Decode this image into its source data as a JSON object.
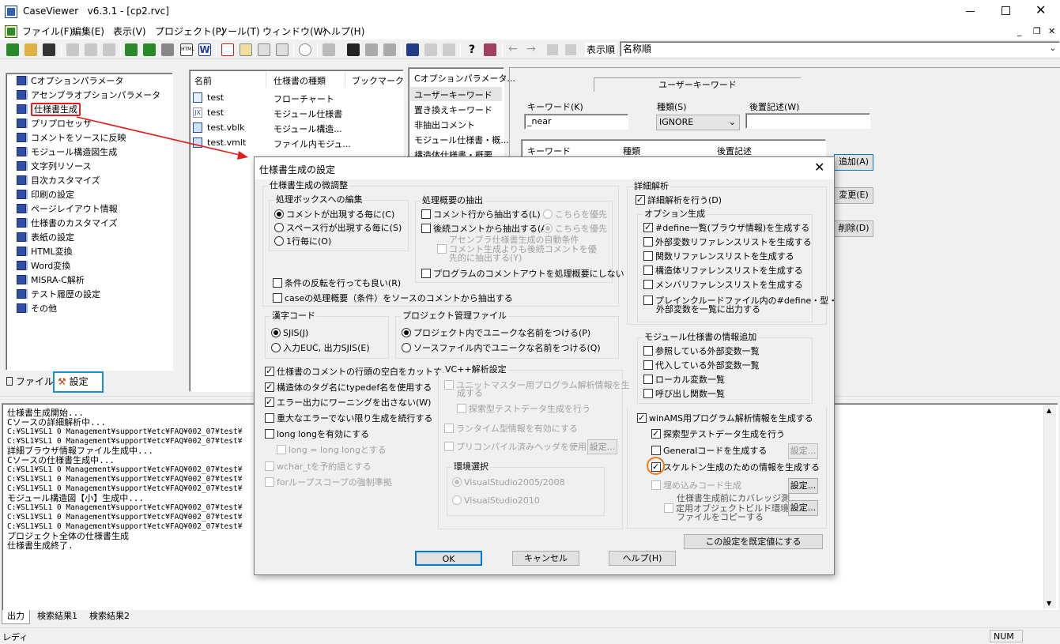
{
  "window": {
    "app": "CaseViewer",
    "version": "v6.3.1",
    "document": "[cp2.rvc]"
  },
  "menu": [
    "ファイル(F)",
    "編集(E)",
    "表示(V)",
    "プロジェクト(P)",
    "ツール(T)",
    "ウィンドウ(W)",
    "ヘルプ(H)"
  ],
  "toolbar": {
    "order_label": "表示順",
    "order_value": "名称順"
  },
  "tree": {
    "items": [
      "Cオプションパラメータ",
      "アセンブラオプションパラメータ",
      "仕様書生成",
      "プリプロセッサ",
      "コメントをソースに反映",
      "モジュール構造図生成",
      "文字列リソース",
      "目次カスタマイズ",
      "印刷の設定",
      "ページレイアウト情報",
      "仕様書のカスタマイズ",
      "表紙の設定",
      "HTML変換",
      "Word変換",
      "MISRA-C解析",
      "テスト履歴の設定",
      "その他"
    ],
    "tab_file": "ファイル",
    "tab_settings": "設定"
  },
  "file_list": {
    "headers": [
      "名前",
      "仕様書の種類",
      "ブックマーク"
    ],
    "rows": [
      {
        "name": "test",
        "type": "フローチャート"
      },
      {
        "name": "test",
        "type": "モジュール仕様書"
      },
      {
        "name": "test.vblk",
        "type": "モジュール構造..."
      },
      {
        "name": "test.vmlt",
        "type": "ファイル内モジュ..."
      }
    ]
  },
  "param_list": [
    "Cオプションパラメータ...",
    "ユーザーキーワード",
    "置き換えキーワード",
    "非抽出コメント",
    "モジュール仕様書・概...",
    "構造体仕様書・概要..."
  ],
  "user_keyword": {
    "title": "ユーザーキーワード",
    "keyword_label": "キーワード(K)",
    "keyword_value": "_near",
    "type_label": "種類(S)",
    "type_value": "IGNORE",
    "postfix_label": "後置記述(W)",
    "postfix_value": "",
    "table_headers": [
      "キーワード",
      "種類",
      "後置記述"
    ],
    "add_button": "追加(A)",
    "change_button": "変更(E)",
    "delete_button": "削除(D)"
  },
  "output": {
    "lines": [
      "仕様書生成開始...",
      "Cソースの詳細解析中...",
      "C:¥SL1¥SL1 0 Management¥support¥etc¥FAQ¥002_07¥test¥",
      "C:¥SL1¥SL1 0 Management¥support¥etc¥FAQ¥002_07¥test¥",
      "詳細ブラウザ情報ファイル生成中...",
      "Cソースの仕様書生成中...",
      "C:¥SL1¥SL1 0 Management¥support¥etc¥FAQ¥002_07¥test¥",
      "C:¥SL1¥SL1 0 Management¥support¥etc¥FAQ¥002_07¥test¥",
      "C:¥SL1¥SL1 0 Management¥support¥etc¥FAQ¥002_07¥test¥",
      "モジュール構造図【小】生成中...",
      "C:¥SL1¥SL1 0 Management¥support¥etc¥FAQ¥002_07¥test¥",
      "C:¥SL1¥SL1 0 Management¥support¥etc¥FAQ¥002_07¥test¥",
      "C:¥SL1¥SL1 0 Management¥support¥etc¥FAQ¥002_07¥test¥",
      "プロジェクト全体の仕様書生成",
      "仕様書生成終了."
    ],
    "tabs": [
      "出力",
      "検索結果1",
      "検索結果2"
    ]
  },
  "status": {
    "text": "レディ",
    "num": "NUM"
  },
  "dialog": {
    "title": "仕様書生成の設定",
    "fine_group": "仕様書生成の微調整",
    "processbox_group": "処理ボックスへの編集",
    "processbox_opts": [
      "コメントが出現する毎に(C)",
      "スペース行が出現する毎に(S)",
      "1行毎に(O)"
    ],
    "summary_group": "処理概要の抽出",
    "summary_opt1": "コメント行から抽出する(L)",
    "summary_opt1_pri": "こちらを優先",
    "summary_opt2": "後続コメントから抽出する(A)",
    "summary_opt2_pri": "こちらを優先",
    "asm_line1": "アセンブラ仕様書生成の自動条件",
    "asm_line2": "コメント生成よりも後続コメントを優",
    "asm_line3": "先的に抽出する(Y)",
    "no_commentout": "プログラムのコメントアウトを処理概要にしない",
    "cond_reverse": "条件の反転を行っても良い(R)",
    "case_summary": "caseの処理概要（条件）をソースのコメントから抽出する",
    "kanji_group": "漢字コード",
    "kanji_opts": [
      "SJIS(J)",
      "入力EUC, 出力SJIS(E)"
    ],
    "projfile_group": "プロジェクト管理ファイル",
    "projfile_opts": [
      "プロジェクト内でユニークな名前をつける(P)",
      "ソースファイル内でユニークな名前をつける(Q)"
    ],
    "left_checks": [
      "仕様書のコメントの行頭の空白をカットする",
      "構造体のタグ名にtypedef名を使用する",
      "エラー出力にワーニングを出さない(W)",
      "重大なエラーでない限り生成を続行する",
      "long longを有効にする",
      "long = long longとする",
      "wchar_tを予約語とする",
      "forループスコープの強制準拠"
    ],
    "vc_group": "VC++解析設定",
    "vc_opt1a": "ユニットマスター用プログラム解析情報を生",
    "vc_opt1b": "成する",
    "vc_opt2": "探索型テストデータ生成を行う",
    "vc_opt3": "ランタイム型情報を有効にする",
    "vc_opt4": "プリコンパイル済みヘッダを使用する",
    "vc_settings": "設定...",
    "env_group": "環境選択",
    "env_opts": [
      "VisualStudio2005/2008",
      "VisualStudio2010"
    ],
    "detail_group": "詳細解析",
    "detail_check": "詳細解析を行う(D)",
    "optgen_group": "オプション生成",
    "optgen_checks": [
      "#define一覧(ブラウザ情報)を生成する",
      "外部変数リファレンスリストを生成する",
      "関数リファレンスリストを生成する",
      "構造体リファレンスリストを生成する",
      "メンバリファレンスリストを生成する"
    ],
    "include_line1": "プレインクルードファイル内の#define・型・",
    "include_line2": "外部変数を一覧に出力する",
    "module_group": "モジュール仕様書の情報追加",
    "module_checks": [
      "参照している外部変数一覧",
      "代入している外部変数一覧",
      "ローカル変数一覧",
      "呼び出し関数一覧"
    ],
    "winams": "winAMS用プログラム解析情報を生成する",
    "winams_sub": [
      "探索型テストデータ生成を行う",
      "Generalコードを生成する",
      "スケルトン生成のための情報を生成する",
      "埋め込みコード生成"
    ],
    "coverage_line1": "仕様書生成前にカバレッジ測",
    "coverage_line2": "定用オブジェクトビルド環境に",
    "coverage_line3": "ファイルをコピーする",
    "settings_btn": "設定...",
    "default_btn": "この設定を既定値にする",
    "ok": "OK",
    "cancel": "キャンセル",
    "help": "ヘルプ(H)"
  },
  "colors": {
    "accent_red": "#e02020",
    "accent_blue": "#1a8fd6",
    "accent_orange": "#f07a1a"
  }
}
